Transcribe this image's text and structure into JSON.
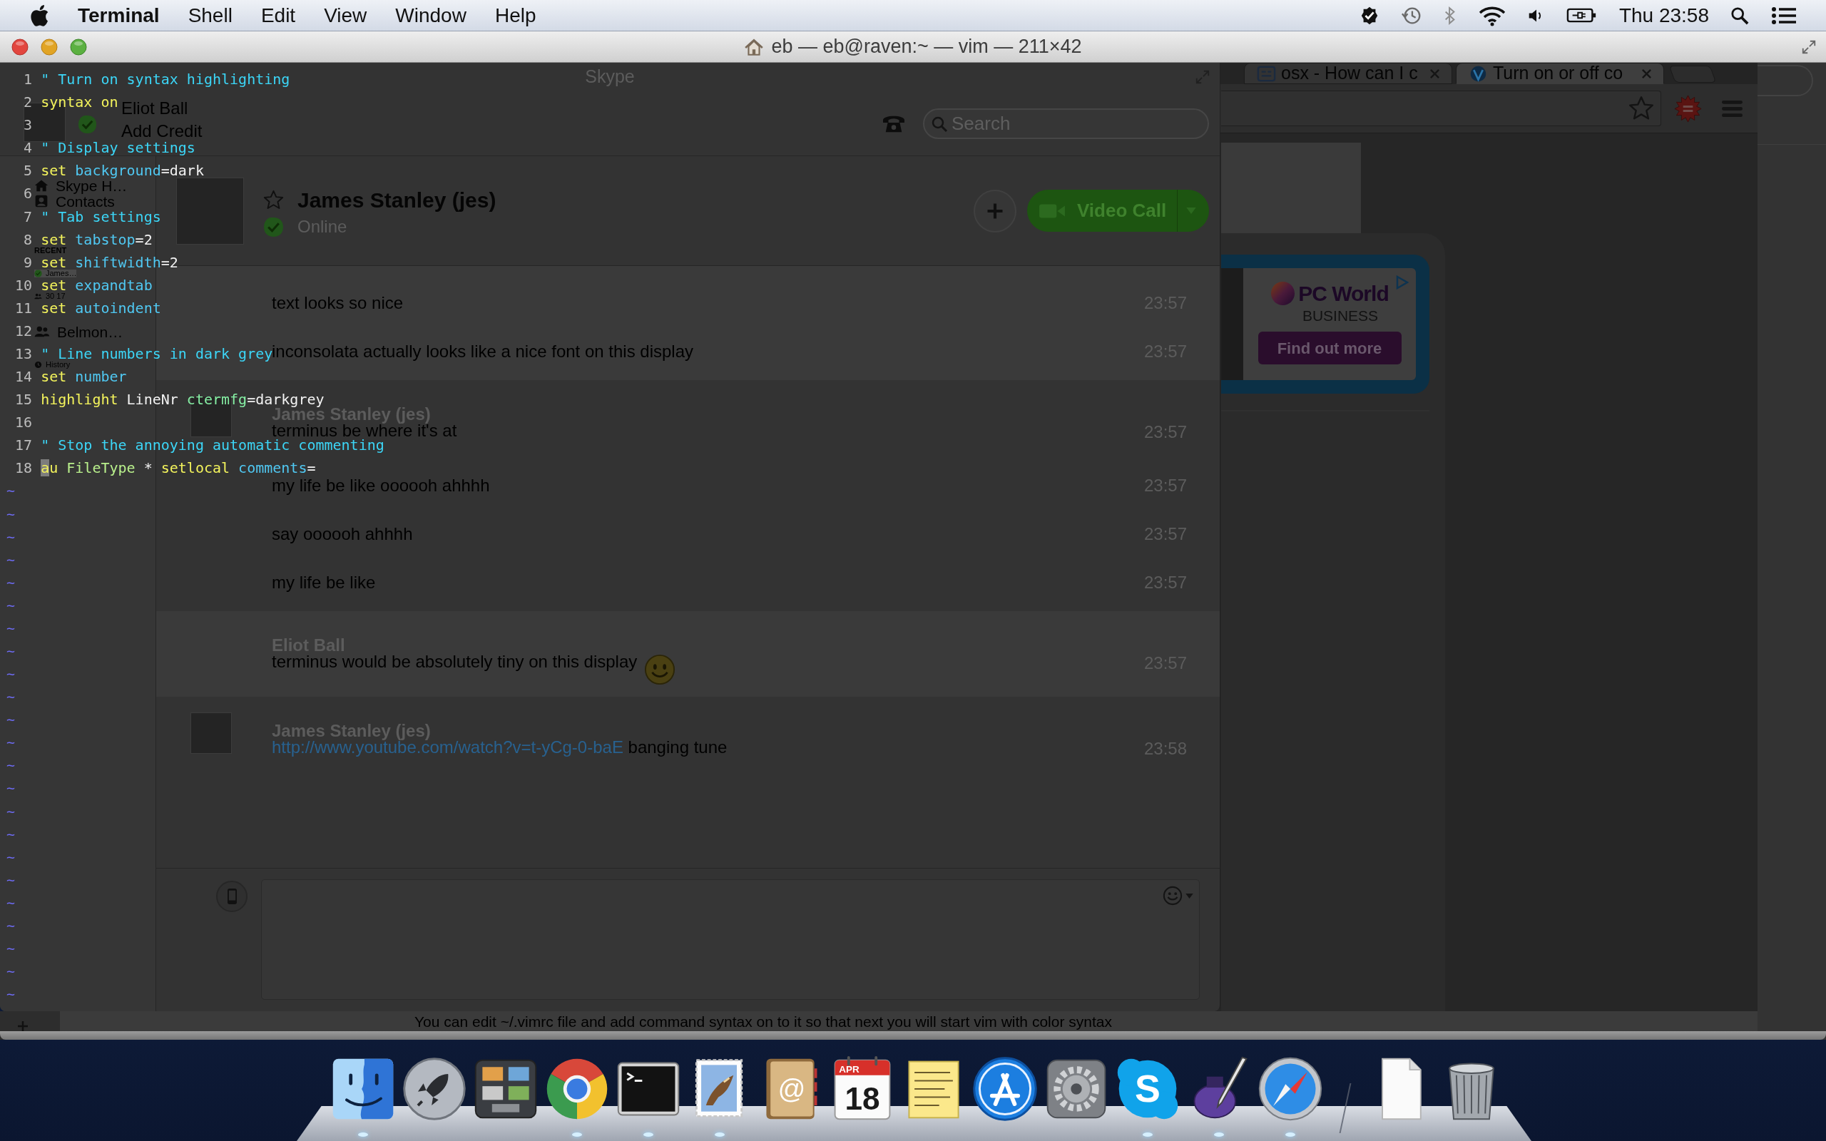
{
  "menubar": {
    "app": "Terminal",
    "menus": [
      "Shell",
      "Edit",
      "View",
      "Window",
      "Help"
    ],
    "clock": "Thu 23:58"
  },
  "terminal": {
    "title": "eb — eb@raven:~ — vim — 211×42",
    "lines": [
      {
        "number": "1",
        "segments": [
          {
            "kind": "comment",
            "text": "\" Turn on syntax highlighting"
          }
        ]
      },
      {
        "number": "2",
        "segments": [
          {
            "kind": "statement",
            "text": "syntax on"
          }
        ]
      },
      {
        "number": "3"
      },
      {
        "number": "4",
        "segments": [
          {
            "kind": "comment",
            "text": "\" Display settings"
          }
        ]
      },
      {
        "number": "5",
        "segments": [
          {
            "kind": "statement",
            "text": "set "
          },
          {
            "kind": "option",
            "text": "background"
          },
          {
            "kind": "plain",
            "text": "=dark"
          }
        ]
      },
      {
        "number": "6"
      },
      {
        "number": "7",
        "segments": [
          {
            "kind": "comment",
            "text": "\" Tab settings"
          }
        ]
      },
      {
        "number": "8",
        "segments": [
          {
            "kind": "statement",
            "text": "set "
          },
          {
            "kind": "option",
            "text": "tabstop"
          },
          {
            "kind": "plain",
            "text": "=2"
          }
        ]
      },
      {
        "number": "9",
        "segments": [
          {
            "kind": "statement",
            "text": "set "
          },
          {
            "kind": "option",
            "text": "shiftwidth"
          },
          {
            "kind": "plain",
            "text": "=2"
          }
        ]
      },
      {
        "number": "10",
        "segments": [
          {
            "kind": "statement",
            "text": "set "
          },
          {
            "kind": "option",
            "text": "expandtab"
          }
        ]
      },
      {
        "number": "11",
        "segments": [
          {
            "kind": "statement",
            "text": "set "
          },
          {
            "kind": "option",
            "text": "autoindent"
          }
        ]
      },
      {
        "number": "12"
      },
      {
        "number": "13",
        "segments": [
          {
            "kind": "comment",
            "text": "\" Line numbers in dark grey"
          }
        ]
      },
      {
        "number": "14",
        "segments": [
          {
            "kind": "statement",
            "text": "set "
          },
          {
            "kind": "option",
            "text": "number"
          }
        ]
      },
      {
        "number": "15",
        "segments": [
          {
            "kind": "statement",
            "text": "highlight "
          },
          {
            "kind": "plain",
            "text": "LineNr "
          },
          {
            "kind": "attribute",
            "text": "ctermfg"
          },
          {
            "kind": "plain",
            "text": "=darkgrey"
          }
        ]
      },
      {
        "number": "16"
      },
      {
        "number": "17",
        "segments": [
          {
            "kind": "comment",
            "text": "\" Stop the annoying automatic commenting"
          }
        ]
      },
      {
        "number": "18",
        "segments": [
          {
            "kind": "cursor",
            "text": "a"
          },
          {
            "kind": "statement",
            "text": "u "
          },
          {
            "kind": "type",
            "text": "FileType"
          },
          {
            "kind": "plain",
            "text": " * "
          },
          {
            "kind": "statement",
            "text": "setlocal "
          },
          {
            "kind": "option",
            "text": "comments"
          },
          {
            "kind": "plain",
            "text": "="
          }
        ]
      }
    ],
    "empty_line_markers": [
      "~",
      "~",
      "~",
      "~",
      "~",
      "~",
      "~",
      "~",
      "~",
      "~",
      "~",
      "~",
      "~",
      "~",
      "~",
      "~",
      "~",
      "~",
      "~",
      "~",
      "~",
      "~",
      "~"
    ]
  },
  "skype": {
    "title": "Skype",
    "profile": {
      "name": "Eliot Ball",
      "credit": "Add Credit"
    },
    "search": {
      "placeholder": "Search"
    },
    "nav": [
      {
        "kind": "home",
        "label": "Skype H…"
      },
      {
        "kind": "contacts",
        "label": "Contacts"
      }
    ],
    "recent": {
      "title": "RECENT",
      "items": [
        {
          "kind": "contact",
          "label": "James…",
          "selected": true
        },
        {
          "kind": "group",
          "label": "30 17",
          "selected": false
        },
        {
          "kind": "group",
          "label": "Belmon…",
          "selected": false
        },
        {
          "kind": "history",
          "label": "History",
          "selected": false
        }
      ]
    },
    "contact": {
      "name": "James Stanley (jes)",
      "status": "Online",
      "button": "Video Call"
    },
    "groups": [
      {
        "shaded": true,
        "avatar": false,
        "messages": [
          {
            "kind": "plain",
            "text": "text looks so nice",
            "time": "23:57"
          },
          {
            "kind": "plain",
            "text": "inconsolata actually looks like a nice font on this display",
            "time": "23:57"
          }
        ]
      },
      {
        "shaded": false,
        "avatar": true,
        "sender": "James Stanley (jes)",
        "messages": [
          {
            "kind": "plain",
            "text": "terminus be where it's at",
            "time": "23:57"
          },
          {
            "kind": "plain",
            "text": "my life be like oooooh ahhhh",
            "time": "23:57"
          },
          {
            "kind": "plain",
            "text": "say oooooh ahhhh",
            "time": "23:57"
          },
          {
            "kind": "plain",
            "text": "my life be like",
            "time": "23:57"
          }
        ]
      },
      {
        "shaded": true,
        "avatar": false,
        "sender": "Eliot Ball",
        "messages": [
          {
            "kind": "emoji",
            "text": "terminus would be absolutely tiny on this display",
            "time": "23:57"
          }
        ]
      },
      {
        "shaded": false,
        "avatar": true,
        "sender": "James Stanley (jes)",
        "messages": [
          {
            "kind": "link",
            "link": "http://www.youtube.com/watch?v=t-yCg-0-baE",
            "text": "banging tune",
            "time": "23:58"
          }
        ]
      }
    ]
  },
  "browser": {
    "tabs": [
      {
        "kind": "square",
        "title": "osx - How can I c",
        "selected": false
      },
      {
        "kind": "round",
        "title": "Turn on or off co",
        "selected": true
      }
    ],
    "ad": {
      "brand": "PC World",
      "subbrand": "BUSINESS",
      "button": "Find out more"
    },
    "answer": "You can edit ~/.vimrc file and add command syntax on to it so that next you will start vim with color syntax"
  },
  "dock": {
    "apps": [
      {
        "kind": "finder",
        "running": true
      },
      {
        "kind": "launchpad",
        "running": false
      },
      {
        "kind": "mission_control",
        "running": false
      },
      {
        "kind": "chrome",
        "running": true
      },
      {
        "kind": "terminal",
        "running": true
      },
      {
        "kind": "mail",
        "running": true
      },
      {
        "kind": "address_book",
        "label": "@",
        "running": false
      },
      {
        "kind": "calendar",
        "month": "APR",
        "day": "18",
        "running": false
      },
      {
        "kind": "stickies",
        "running": false
      },
      {
        "kind": "app_store",
        "running": false
      },
      {
        "kind": "system_preferences",
        "running": false
      },
      {
        "kind": "skype",
        "label": "S",
        "running": true
      },
      {
        "kind": "ink",
        "running": true
      },
      {
        "kind": "safari",
        "running": true
      }
    ],
    "stacks": [
      {
        "kind": "document"
      },
      {
        "kind": "trash"
      }
    ]
  }
}
